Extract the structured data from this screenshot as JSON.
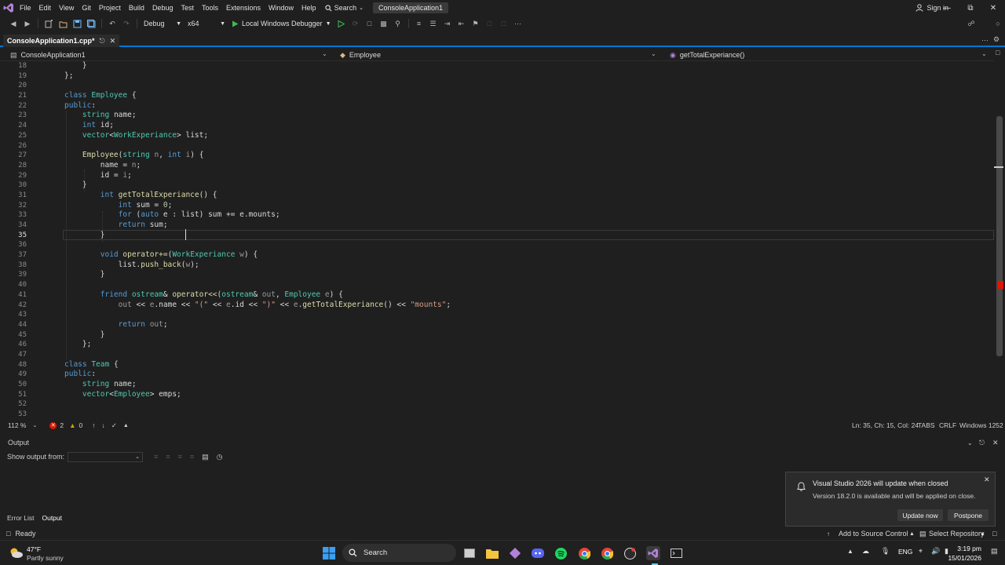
{
  "menubar": {
    "items": [
      "File",
      "Edit",
      "View",
      "Git",
      "Project",
      "Build",
      "Debug",
      "Test",
      "Tools",
      "Extensions",
      "Window",
      "Help"
    ],
    "search_label": "Search",
    "solution_title": "ConsoleApplication1",
    "signin_label": "Sign in"
  },
  "toolbar": {
    "config": "Debug",
    "platform": "x64",
    "debugger_label": "Local Windows Debugger"
  },
  "tab": {
    "title": "ConsoleApplication1.cpp*"
  },
  "navbar": {
    "project": "ConsoleApplication1",
    "class": "Employee",
    "member": "getTotalExperiance()"
  },
  "editor": {
    "line_numbers": [
      "18",
      "19",
      "20",
      "21",
      "22",
      "23",
      "24",
      "25",
      "26",
      "27",
      "28",
      "29",
      "30",
      "31",
      "32",
      "33",
      "34",
      "35",
      "36",
      "37",
      "38",
      "39",
      "40",
      "41",
      "42",
      "43",
      "44",
      "45",
      "46",
      "47",
      "48",
      "49",
      "50",
      "51",
      "52",
      "53"
    ],
    "current_line": "35"
  },
  "edstatus": {
    "zoom": "112 %",
    "errors": "2",
    "warnings": "0",
    "position": "Ln: 35, Ch: 15, Col: 24",
    "indent": "TABS",
    "line_ending": "CRLF",
    "encoding": "Windows 1252"
  },
  "output": {
    "title": "Output",
    "show_from_label": "Show output from:"
  },
  "bottom_tabs": [
    "Error List",
    "Output"
  ],
  "toast": {
    "title": "Visual Studio 2026 will update when closed",
    "body": "Version 18.2.0 is available and will be applied on close.",
    "update_label": "Update now",
    "postpone_label": "Postpone"
  },
  "statusbar": {
    "ready": "Ready",
    "source_control": "Add to Source Control",
    "repository": "Select Repository"
  },
  "taskbar": {
    "weather_temp": "47°F",
    "weather_desc": "Partly sunny",
    "search_label": "Search",
    "language": "ENG",
    "time": "3:19 pm",
    "date": "15/01/2026"
  },
  "colors": {
    "accent": "#0078d4",
    "keyword": "#569cd6",
    "type": "#4ec9b0",
    "function": "#dcdcaa",
    "string": "#d69d85",
    "error": "#e51400",
    "warning": "#cca700"
  }
}
